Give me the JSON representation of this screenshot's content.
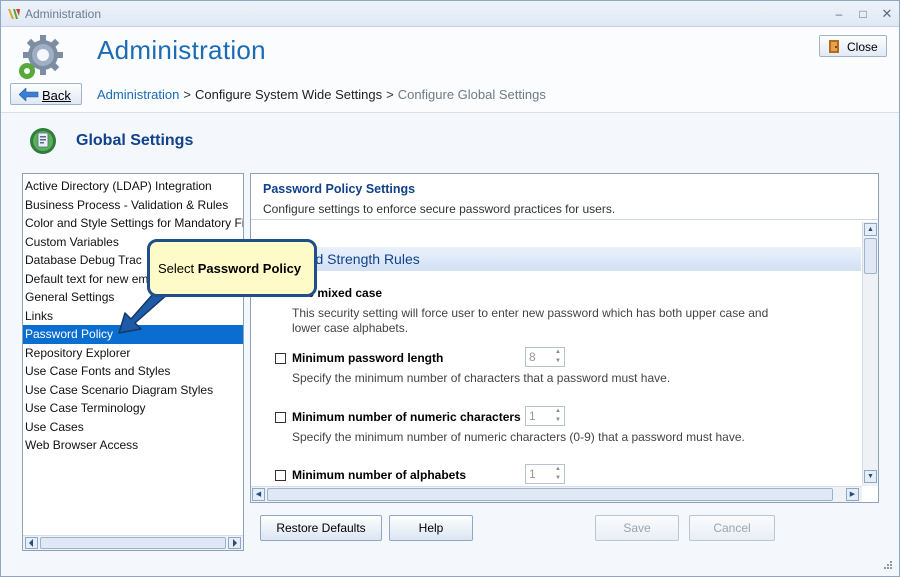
{
  "window": {
    "title": "Administration",
    "controls": {
      "minimize": "–",
      "maximize": "□",
      "close": "✕"
    }
  },
  "header": {
    "title": "Administration",
    "close_label": "Close",
    "back_label": "Back",
    "breadcrumb": {
      "link": "Administration",
      "separator": ">",
      "middle": "Configure System Wide Settings",
      "current": "Configure Global Settings"
    }
  },
  "section": {
    "title": "Global Settings"
  },
  "sidebar": {
    "items": [
      {
        "label": "Active Directory (LDAP) Integration"
      },
      {
        "label": "Business Process - Validation & Rules"
      },
      {
        "label": "Color and Style Settings for Mandatory Fie"
      },
      {
        "label": "Custom Variables"
      },
      {
        "label": "Database Debug Trac"
      },
      {
        "label": "Default text for new em"
      },
      {
        "label": "General Settings"
      },
      {
        "label": "Links"
      },
      {
        "label": "Password Policy"
      },
      {
        "label": "Repository Explorer"
      },
      {
        "label": "Use Case Fonts and Styles"
      },
      {
        "label": "Use Case Scenario Diagram Styles"
      },
      {
        "label": "Use Case Terminology"
      },
      {
        "label": "Use Cases"
      },
      {
        "label": "Web Browser Access"
      }
    ],
    "selected_index": 8
  },
  "panel": {
    "title": "Password Policy Settings",
    "subtitle": "Configure settings to enforce secure password practices for users.",
    "band_label": "ord Strength Rules",
    "rules": [
      {
        "name": "uire mixed case",
        "desc": "This security setting will force user to enter new password which has both upper case and lower case alphabets.",
        "has_spinner": false,
        "value": ""
      },
      {
        "name": "Minimum password length",
        "desc": "Specify the minimum number of characters that a password must have.",
        "has_spinner": true,
        "value": "8"
      },
      {
        "name": "Minimum number of numeric characters",
        "desc": "Specify the minimum number of numeric characters (0-9) that a password must have.",
        "has_spinner": true,
        "value": "1"
      },
      {
        "name": "Minimum number of alphabets",
        "desc": "",
        "has_spinner": true,
        "value": "1"
      }
    ]
  },
  "buttons": {
    "restore": "Restore Defaults",
    "help": "Help",
    "save": "Save",
    "cancel": "Cancel"
  },
  "callout": {
    "prefix": "Select ",
    "emphasis": "Password Policy"
  },
  "colors": {
    "accent": "#1c6bb5",
    "selection": "#0a6ed1",
    "callout_bg": "#fffbc8",
    "callout_border": "#1f4e88"
  }
}
